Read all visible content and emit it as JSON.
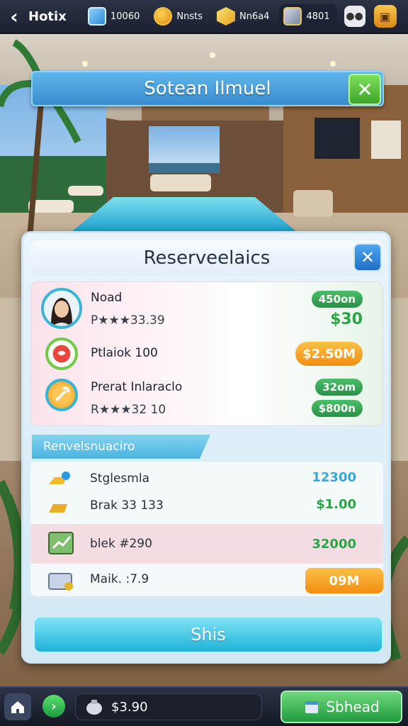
{
  "topbar": {
    "back_icon": "chevron-left-icon",
    "title": "Hotix",
    "gems": "10060",
    "coins_label": "Nnsts",
    "gold": "Nn6a4",
    "cash": "4801",
    "menu_icon": "menu-icon",
    "shop_icon": "shop-icon"
  },
  "banner": {
    "title": "Sotean Ilmuel",
    "close_icon": "close-icon"
  },
  "panel": {
    "title": "Reserveelaics",
    "close_icon": "close-icon",
    "reservations": [
      {
        "name": "Noad",
        "sub": "P★★★33.39",
        "badge": "450on",
        "price": "$30"
      },
      {
        "name": "Ptlaiok 100",
        "badge": "$2.50M"
      },
      {
        "name": "Prerat Inlaraclo",
        "sub": "R★★★32 10",
        "badge_top": "32om",
        "badge_bottom": "$800n"
      }
    ],
    "subtab": "Renvelsnuaciro",
    "items": [
      {
        "label": "Stglesmla",
        "value": "12300",
        "icon": "gold-bars-icon"
      },
      {
        "label": "Brak 33 133",
        "value": "$1.00",
        "icon": "gold-bar-icon"
      },
      {
        "label": "blek #290",
        "value": "32000",
        "icon": "chart-board-icon"
      },
      {
        "label": "Maik. :7.9",
        "value": "09M",
        "icon": "cash-register-icon"
      }
    ],
    "action_label": "Shis"
  },
  "bottombar": {
    "home_icon": "home-icon",
    "go_icon": "arrow-right-icon",
    "balance": "$3.90",
    "schedule_label": "Sbhead"
  },
  "colors": {
    "accent_blue": "#3a8ccf",
    "green": "#2aa446",
    "orange": "#f08d10",
    "cyan_button": "#21b3d9"
  }
}
